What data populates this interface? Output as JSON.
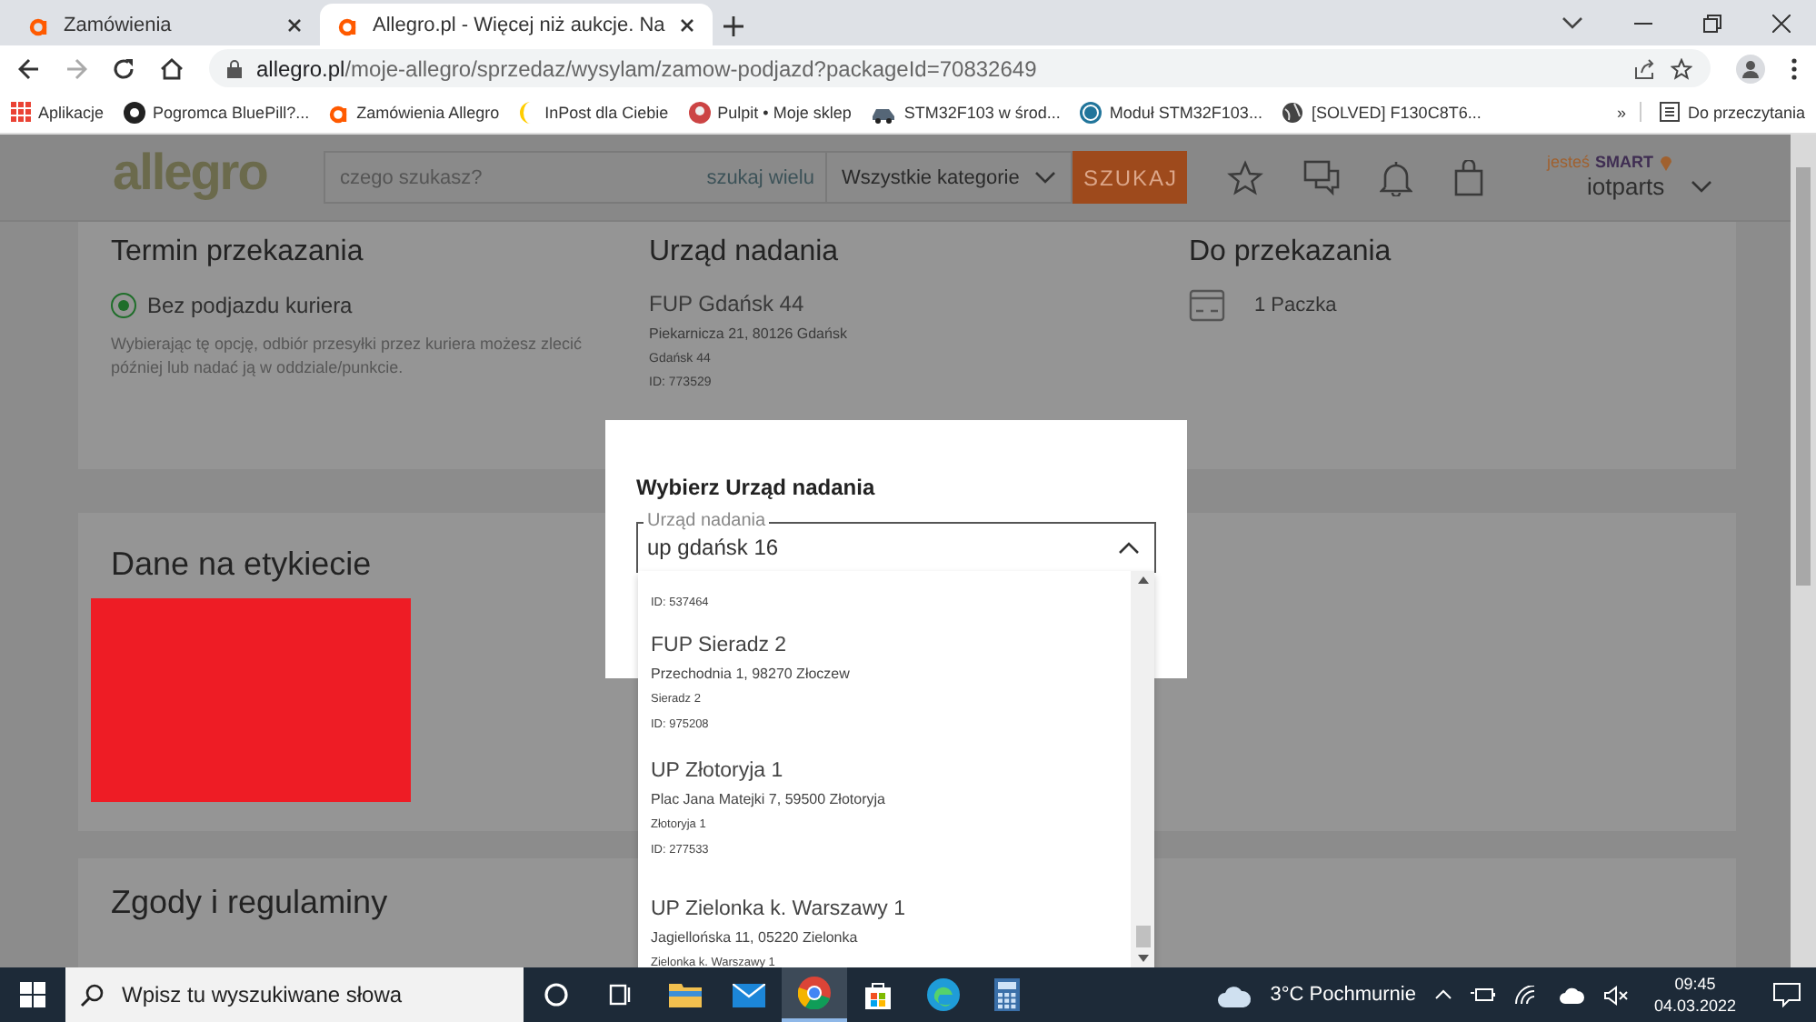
{
  "browser": {
    "tabs": [
      {
        "title": "Zamówienia",
        "selected": false
      },
      {
        "title": "Allegro.pl - Więcej niż aukcje. Na",
        "selected": true
      }
    ],
    "url_host": "allegro.pl",
    "url_path": "/moje-allegro/sprzedaz/wysylam/zamow-podjazd?packageId=70832649",
    "bookmarks": [
      {
        "label": "Aplikacje",
        "kind": "apps"
      },
      {
        "label": "Pogromca BluePill?...",
        "kind": "dark"
      },
      {
        "label": "Zamówienia Allegro",
        "kind": "allegro"
      },
      {
        "label": "InPost dla Ciebie",
        "kind": "inpost"
      },
      {
        "label": "Pulpit • Moje sklep",
        "kind": "avatar"
      },
      {
        "label": "STM32F103 w środ...",
        "kind": "car"
      },
      {
        "label": "Moduł STM32F103...",
        "kind": "wordpress"
      },
      {
        "label": "[SOLVED] F130C8T6...",
        "kind": "globe"
      }
    ],
    "bookmarks_more": "»",
    "reading_list": "Do przeczytania"
  },
  "header": {
    "logo": "allegro",
    "search_placeholder": "czego szukasz?",
    "search_many": "szukaj wielu",
    "category": "Wszystkie kategorie",
    "search_button": "SZUKAJ",
    "smart_prefix": "jesteś",
    "smart_label": "SMART",
    "user": "iotparts"
  },
  "handover": {
    "term_title": "Termin przekazania",
    "option_label": "Bez podjazdu kuriera",
    "option_checked": true,
    "option_description": "Wybierając tę opcję, odbiór przesyłki przez kuriera możesz zlecić później lub nadać ją w oddziale/punkcie.",
    "office_title": "Urząd nadania",
    "office_name": "FUP Gdańsk 44",
    "office_address": "Piekarnicza 21, 80126 Gdańsk",
    "office_short": "Gdańsk 44",
    "office_id": "ID: 773529",
    "parcels_title": "Do przekazania",
    "parcels_count": "1 Paczka"
  },
  "label_section": {
    "title": "Dane na etykiecie"
  },
  "consents": {
    "title": "Zgody i regulaminy"
  },
  "modal": {
    "title": "Wybierz Urząd nadania",
    "field_label": "Urząd nadania",
    "value": "up gdańsk 16",
    "expanded": true,
    "options": [
      {
        "id": "ID: 537464"
      },
      {
        "name": "FUP Sieradz 2",
        "address": "Przechodnia 1, 98270 Złoczew",
        "short": "Sieradz 2",
        "id": "ID: 975208"
      },
      {
        "name": "UP Złotoryja 1",
        "address": "Plac Jana Matejki 7, 59500 Złotoryja",
        "short": "Złotoryja 1",
        "id": "ID: 277533"
      },
      {
        "name": "UP Zielonka k. Warszawy 1",
        "address": "Jagiellońska 11, 05220 Zielonka",
        "short": "Zielonka k. Warszawy 1"
      }
    ]
  },
  "taskbar": {
    "search_placeholder": "Wpisz tu wyszukiwane słowa",
    "apps": [
      {
        "kind": "cortana",
        "selected": false
      },
      {
        "kind": "taskview",
        "selected": false
      },
      {
        "kind": "explorer",
        "selected": false
      },
      {
        "kind": "mail",
        "selected": false
      },
      {
        "kind": "chrome",
        "selected": true
      },
      {
        "kind": "store",
        "selected": false
      },
      {
        "kind": "edge",
        "selected": false
      },
      {
        "kind": "calculator",
        "selected": false
      }
    ],
    "weather": "3°C Pochmurnie",
    "time": "09:45",
    "date": "04.03.2022"
  }
}
